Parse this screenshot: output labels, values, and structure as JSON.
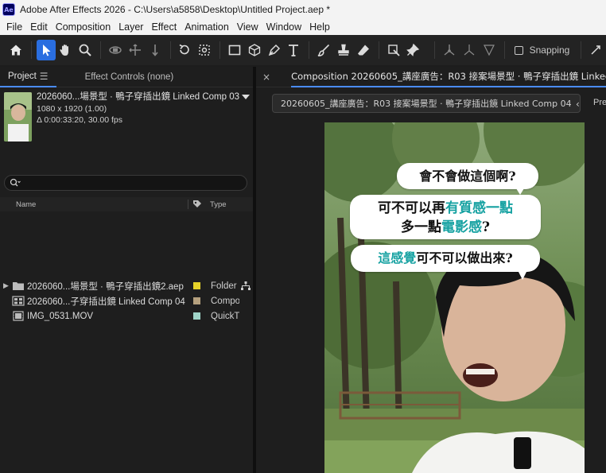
{
  "window": {
    "app_badge": "Ae",
    "title": "Adobe After Effects 2026 - C:\\Users\\a5858\\Desktop\\Untitled Project.aep *"
  },
  "menu": [
    "File",
    "Edit",
    "Composition",
    "Layer",
    "Effect",
    "Animation",
    "View",
    "Window",
    "Help"
  ],
  "toolbar": {
    "tools": [
      "home-icon",
      "selection-arrow-icon",
      "hand-icon",
      "zoom-icon",
      "orbit-camera-icon",
      "pan-camera-icon",
      "dolly-camera-icon",
      "rotate-icon",
      "pan-behind-icon",
      "rectangle-icon",
      "cube-icon",
      "pen-icon",
      "text-icon",
      "brush-icon",
      "clone-stamp-icon",
      "eraser-icon",
      "roto-brush-icon",
      "puppet-pin-icon"
    ],
    "active_tool": "selection-arrow-icon",
    "snapping_label": "Snapping",
    "snapping_checked": false
  },
  "project_panel": {
    "tabs": [
      "Project",
      "Effect Controls (none)"
    ],
    "active_tab": "Project",
    "selected_item": {
      "name": "2026060...場景型 · 鴨子穿插出鏡 Linked Comp 03",
      "resolution": "1080 x 1920 (1.00)",
      "duration": "Δ 0:00:33:20, 30.00 fps"
    },
    "search": {
      "placeholder": "",
      "value": ""
    },
    "columns": {
      "name": "Name",
      "type": "Type"
    },
    "items": [
      {
        "name": "2026060...場景型 · 鴨子穿插出鏡2.aep",
        "type": "Folder",
        "kind": "folder-icon",
        "label_color": "#e6d229"
      },
      {
        "name": "2026060...子穿插出鏡 Linked Comp 04",
        "type": "Compo",
        "kind": "composition-icon",
        "label_color": "#b5a07e"
      },
      {
        "name": "IMG_0531.MOV",
        "type": "QuickTi",
        "kind": "footage-icon",
        "label_color": "#9fd4c8"
      }
    ]
  },
  "composition_panel": {
    "tab_title": "Composition 20260605_講座廣告：R03 接案場景型 · 鴨子穿插出鏡 Linked",
    "breadcrumb": "20260605_講座廣告：R03 接案場景型 · 鴨子穿插出鏡 Linked Comp 04",
    "right_cut_label": "Pre",
    "bubbles": [
      {
        "text": "會不會做這個啊?"
      },
      {
        "line1_a": "可不可以再",
        "line1_b": "有質感一點",
        "line2_a": "多一點",
        "line2_b": "電影感",
        "line2_c": "?"
      },
      {
        "text_a": "這感覺",
        "text_b": "可不可以做出來?"
      }
    ],
    "accent_color": "#17a2a2"
  }
}
